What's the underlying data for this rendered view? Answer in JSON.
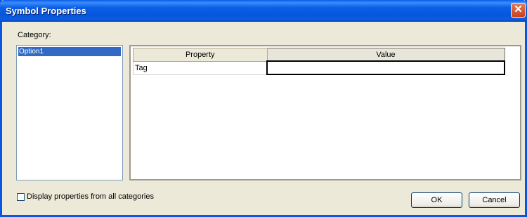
{
  "window": {
    "title": "Symbol Properties",
    "close_glyph": "✕"
  },
  "category": {
    "label": "Category:",
    "items": [
      {
        "label": "Option1",
        "selected": true
      }
    ]
  },
  "table": {
    "columns": [
      "Property",
      "Value"
    ],
    "rows": [
      {
        "property": "Tag",
        "value": ""
      }
    ]
  },
  "checkbox": {
    "label": "Display properties from all categories",
    "checked": false
  },
  "buttons": {
    "ok": "OK",
    "cancel": "Cancel"
  },
  "colors": {
    "titlebar": "#0a5ee9",
    "selection": "#316ac5",
    "dialog_bg": "#ece9d8"
  }
}
